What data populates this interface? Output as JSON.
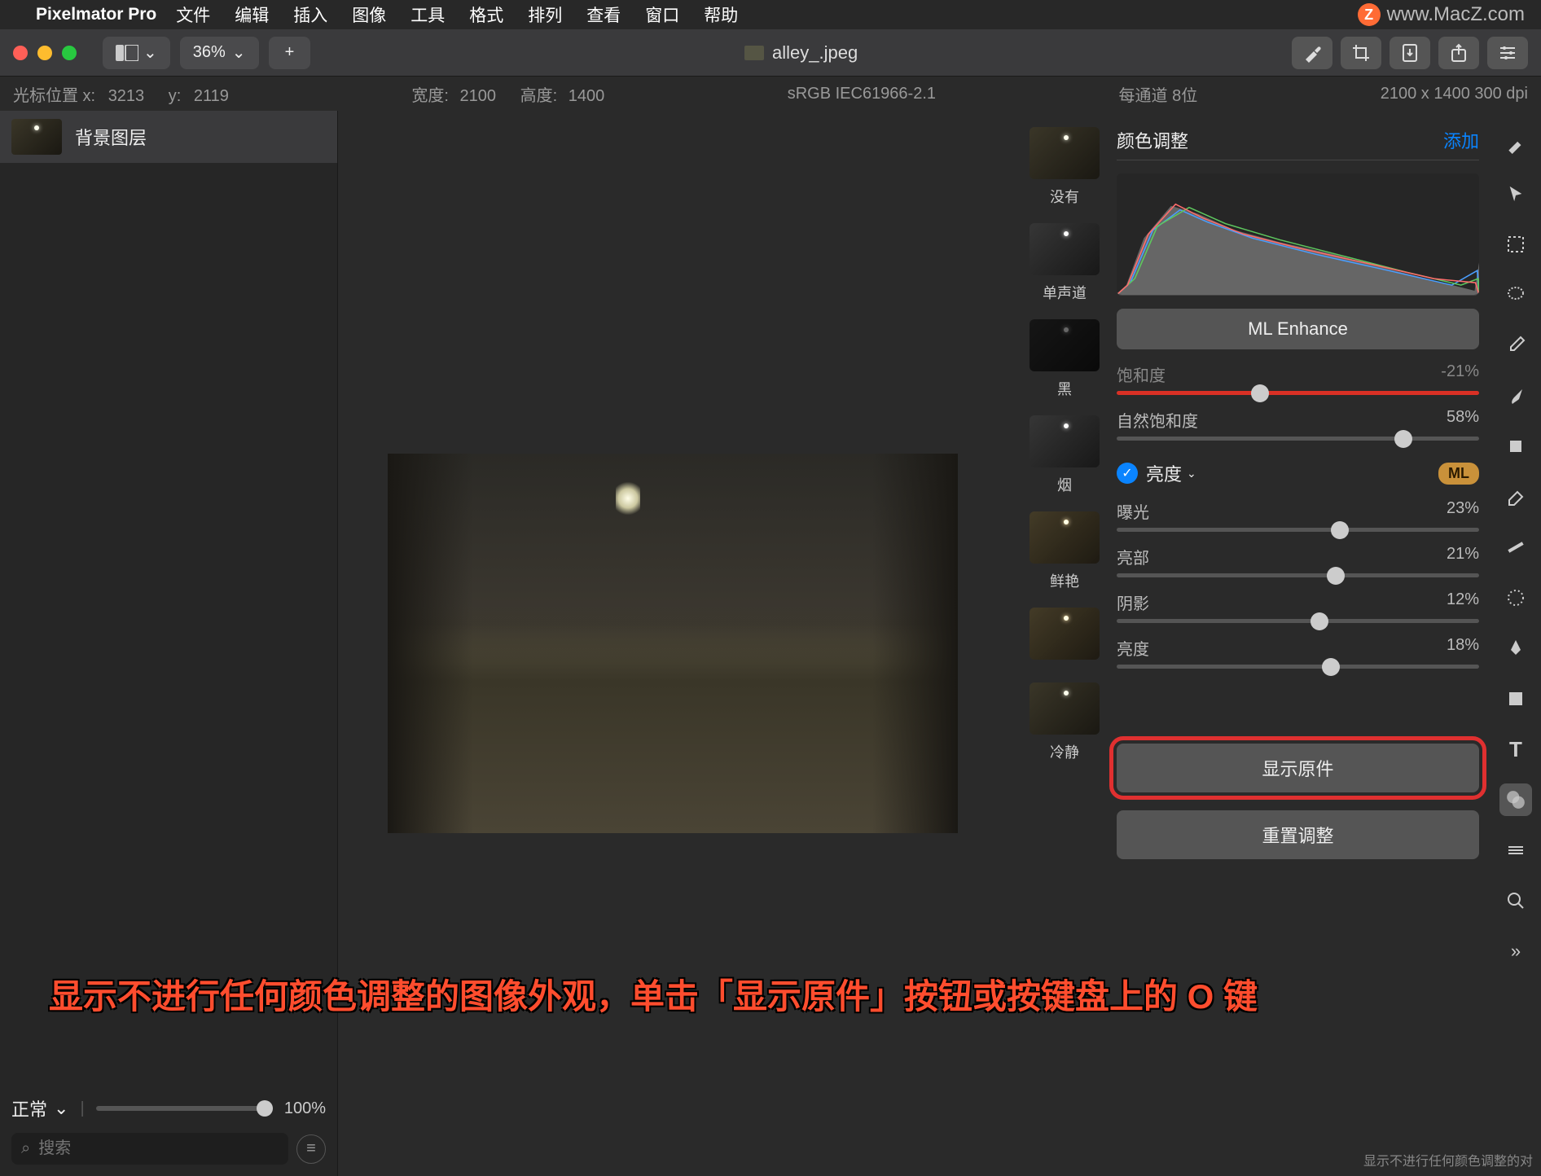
{
  "menubar": {
    "app_name": "Pixelmator Pro",
    "items": [
      "文件",
      "编辑",
      "插入",
      "图像",
      "工具",
      "格式",
      "排列",
      "查看",
      "窗口",
      "帮助"
    ],
    "watermark": "www.MacZ.com"
  },
  "toolbar": {
    "zoom": "36%",
    "title": "alley_.jpeg"
  },
  "infobar": {
    "cursor_label": "光标位置 x:",
    "cursor_x": "3213",
    "cursor_y_label": "y:",
    "cursor_y": "2119",
    "width_label": "宽度:",
    "width": "2100",
    "height_label": "高度:",
    "height": "1400",
    "profile": "sRGB IEC61966-2.1",
    "depth": "每通道 8位",
    "dims": "2100 x 1400 300 dpi"
  },
  "layers": {
    "items": [
      {
        "name": "背景图层"
      }
    ],
    "blend_mode": "正常",
    "opacity": "100%",
    "search_placeholder": "搜索"
  },
  "adjustments": {
    "header": "颜色调整",
    "add": "添加",
    "ml_enhance": "ML Enhance",
    "presets": [
      {
        "label": "没有",
        "cls": ""
      },
      {
        "label": "单声道",
        "cls": "bw"
      },
      {
        "label": "黑",
        "cls": "dark"
      },
      {
        "label": "烟",
        "cls": "bw"
      },
      {
        "label": "鲜艳",
        "cls": "warm"
      },
      {
        "label": "",
        "cls": "warm"
      },
      {
        "label": "冷静",
        "cls": ""
      }
    ],
    "saturation": {
      "label": "饱和度",
      "value": "-21%",
      "pos": 39.5
    },
    "vibrance": {
      "label": "自然饱和度",
      "value": "58%",
      "pos": 79
    },
    "brightness_group": "亮度",
    "ml_badge": "ML",
    "exposure": {
      "label": "曝光",
      "value": "23%",
      "pos": 61.5
    },
    "highlights": {
      "label": "亮部",
      "value": "21%",
      "pos": 60.5
    },
    "shadows": {
      "label": "阴影",
      "value": "12%",
      "pos": 56
    },
    "brightness": {
      "label": "亮度",
      "value": "18%",
      "pos": 59
    },
    "show_original": "显示原件",
    "reset": "重置调整",
    "corner_tip": "显示不进行任何颜色调整的对"
  },
  "annotation": "显示不进行任何颜色调整的图像外观，单击「显示原件」按钮或按键盘上的 O 键"
}
